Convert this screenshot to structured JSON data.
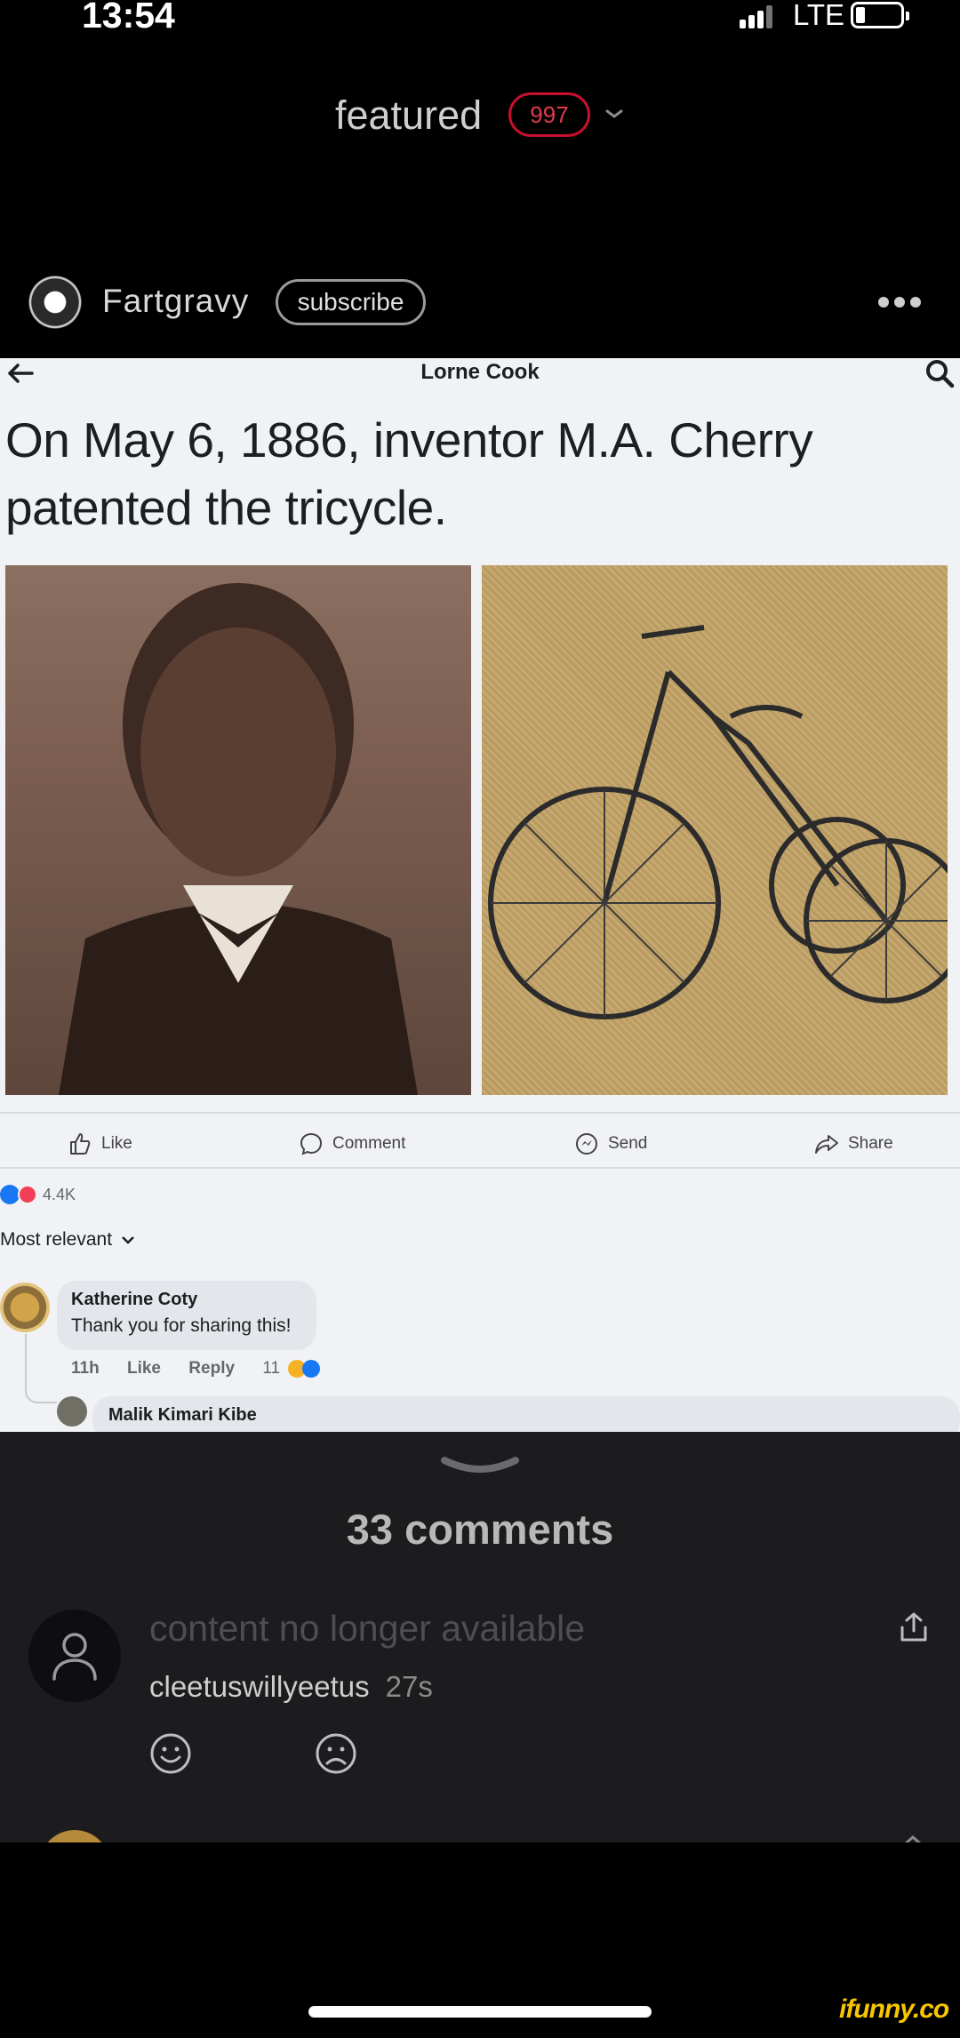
{
  "status_bar": {
    "time": "13:54",
    "network": "LTE"
  },
  "header": {
    "feed_label": "featured",
    "feed_count": "997",
    "accent_color": "#c8102e"
  },
  "author": {
    "name": "Fartgravy",
    "subscribe_label": "subscribe"
  },
  "post_image": {
    "page_name": "Lorne Cook",
    "post_text": "On May 6, 1886, inventor M.A. Cherry patented the tricycle.",
    "actions": {
      "like": "Like",
      "comment": "Comment",
      "send": "Send",
      "share": "Share"
    },
    "reaction_count": "4.4K",
    "sort_label": "Most relevant",
    "comment": {
      "author": "Katherine Coty",
      "text": "Thank you for sharing this!",
      "time": "11h",
      "like": "Like",
      "reply": "Reply",
      "reaction_count": "11"
    },
    "reply": {
      "author": "Malik Kimari Kibe"
    }
  },
  "comments_panel": {
    "count_label": "33 comments",
    "comments": [
      {
        "text": "content no longer available",
        "username": "cleetuswillyeetus",
        "time": "27s"
      }
    ]
  },
  "watermark": "ifunny.co"
}
